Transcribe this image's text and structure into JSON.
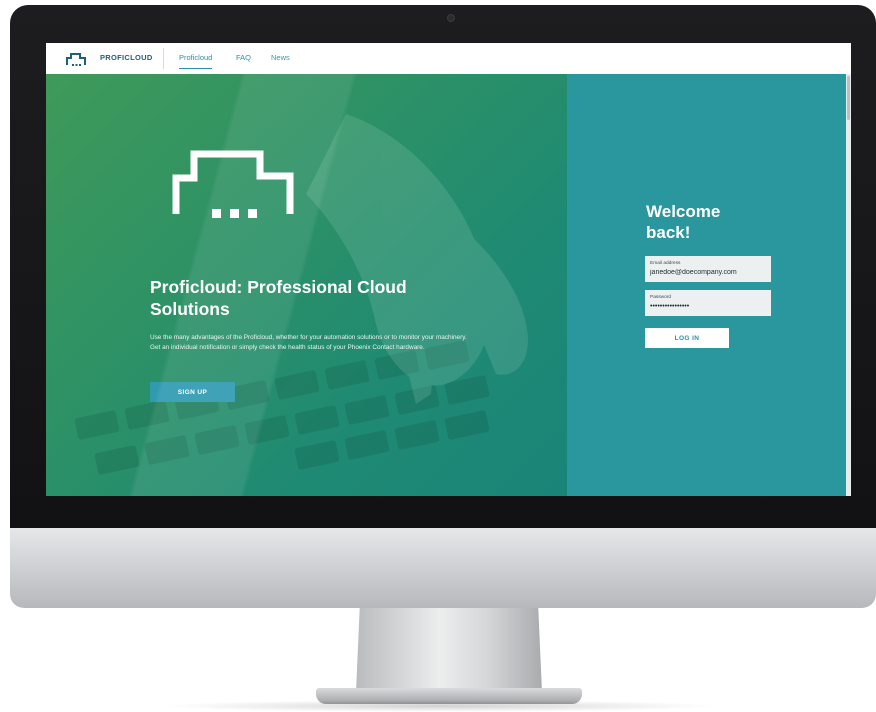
{
  "nav": {
    "brand": "PROFICLOUD",
    "links": [
      {
        "label": "Proficloud",
        "active": true
      },
      {
        "label": "FAQ",
        "active": false
      },
      {
        "label": "News",
        "active": false
      }
    ]
  },
  "hero": {
    "title": "Proficloud: Professional Cloud Solutions",
    "description": "Use the many advantages of the Proficloud, whether for your automation solutions or to monitor your machinery. Get an individual notification or simply check the health status of your Phoenix Contact hardware.",
    "signup_label": "SIGN UP",
    "icon": "proficloud-cloud-icon"
  },
  "login": {
    "heading": "Welcome back!",
    "email_label": "Email address",
    "email_value": "janedoe@doecompany.com",
    "password_label": "Password",
    "password_value": "••••••••••••••••",
    "button_label": "LOG IN"
  },
  "colors": {
    "brand_teal": "#2a969d",
    "hero_green": "#3f9a59",
    "accent_link": "#2a8fa7"
  }
}
